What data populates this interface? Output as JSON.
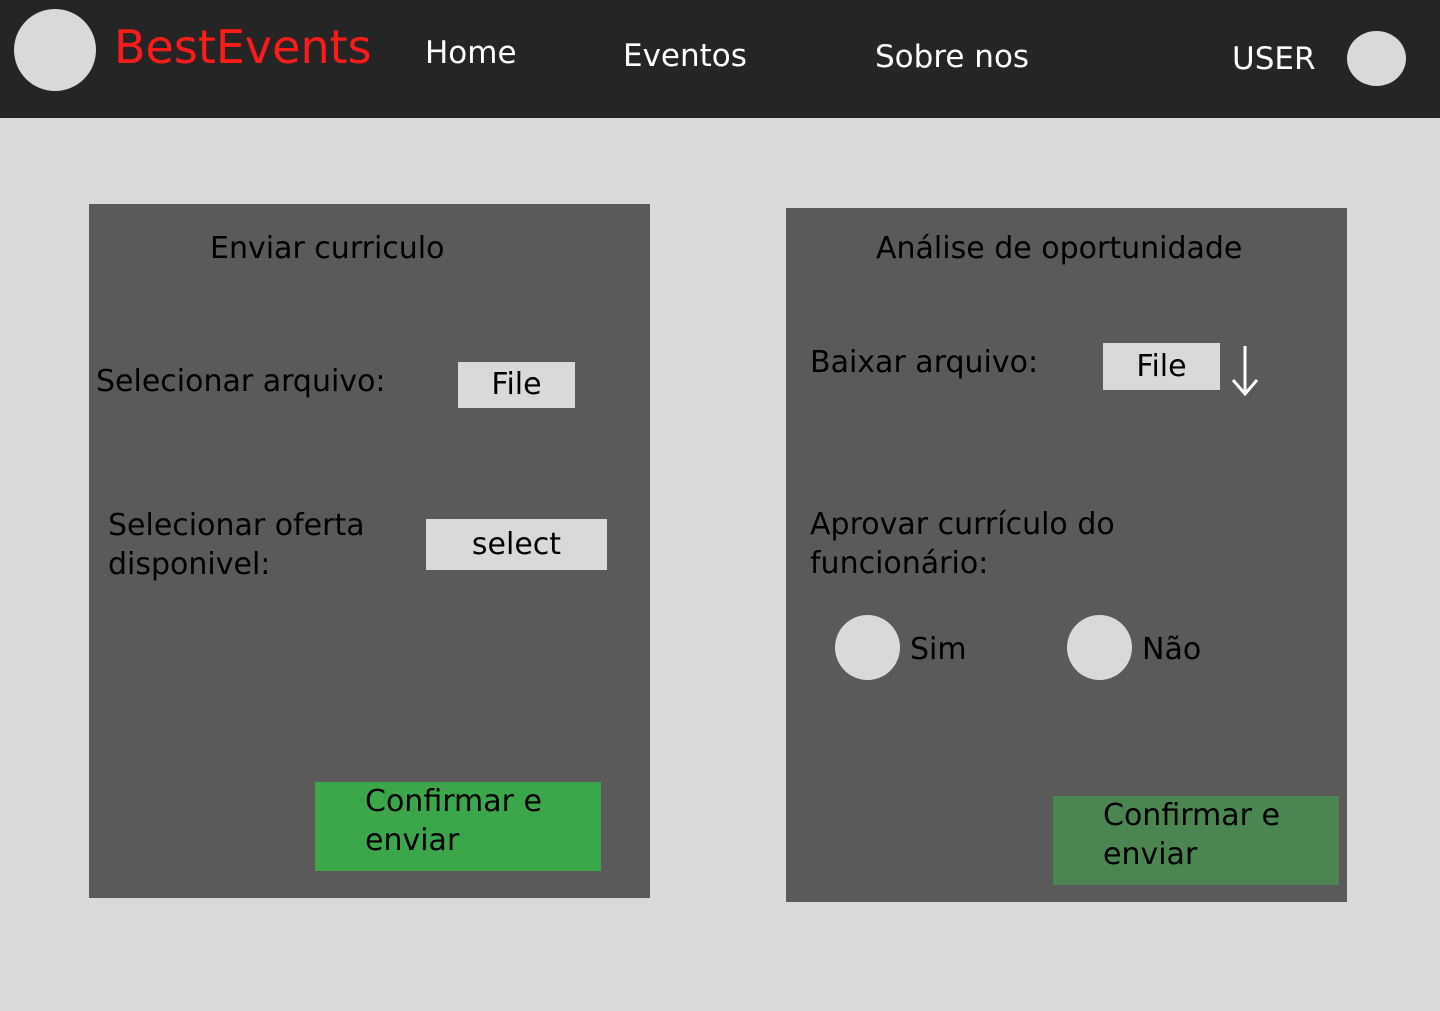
{
  "header": {
    "brand": "BestEvents",
    "nav": {
      "home": "Home",
      "eventos": "Eventos",
      "sobre": "Sobre nos"
    },
    "user_label": "USER",
    "colors": {
      "background": "#252525",
      "brand": "#ff1a1a",
      "nav_text": "#ffffff"
    }
  },
  "left_panel": {
    "title": "Enviar curriculo",
    "file_label": "Selecionar arquivo:",
    "file_button": "File",
    "offer_label_line1": "Selecionar oferta",
    "offer_label_line2": "disponivel:",
    "offer_select": "select",
    "submit_line1": "Confirmar e",
    "submit_line2": "enviar",
    "submit_color": "#3ca64a"
  },
  "right_panel": {
    "title": "Análise de oportunidade",
    "download_label": "Baixar arquivo:",
    "download_button": "File",
    "download_icon": "arrow-down-icon",
    "approve_label_line1": "Aprovar currículo do",
    "approve_label_line2": "funcionário:",
    "option_yes": "Sim",
    "option_no": "Não",
    "submit_line1": "Confirmar e",
    "submit_line2": "enviar",
    "submit_color": "#4a8552"
  },
  "colors": {
    "page_background": "#d9d9d9",
    "panel_background": "#5a5a5a",
    "control_background": "#d9d9d9"
  }
}
